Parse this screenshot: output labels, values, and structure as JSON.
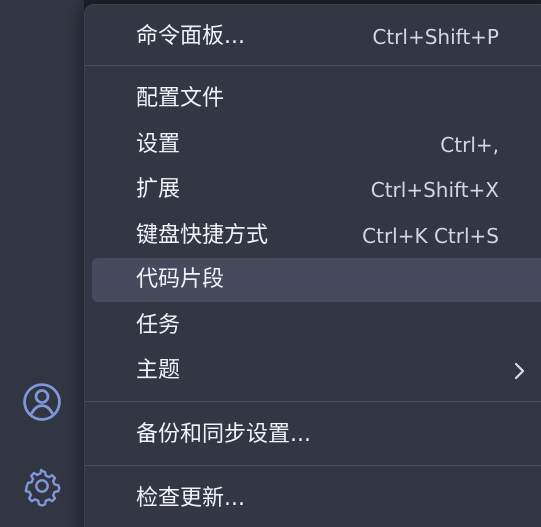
{
  "activity_bar": {
    "icons": [
      "account-icon",
      "gear-icon"
    ]
  },
  "menu": {
    "items": [
      {
        "label": "命令面板...",
        "shortcut": "Ctrl+Shift+P"
      },
      {
        "label": "配置文件",
        "shortcut": ""
      },
      {
        "label": "设置",
        "shortcut": "Ctrl+,"
      },
      {
        "label": "扩展",
        "shortcut": "Ctrl+Shift+X"
      },
      {
        "label": "键盘快捷方式",
        "shortcut": "Ctrl+K Ctrl+S"
      },
      {
        "label": "代码片段",
        "shortcut": ""
      },
      {
        "label": "任务",
        "shortcut": ""
      },
      {
        "label": "主题",
        "shortcut": ""
      },
      {
        "label": "备份和同步设置...",
        "shortcut": ""
      },
      {
        "label": "检查更新...",
        "shortcut": ""
      }
    ],
    "active_item": "代码片段"
  },
  "colors": {
    "activity_bar_bg": "#323542",
    "menu_bg": "#333643",
    "menu_active_bg": "#464a5d",
    "icon_accent": "#7f98d8",
    "text": "#f1f3f8"
  }
}
